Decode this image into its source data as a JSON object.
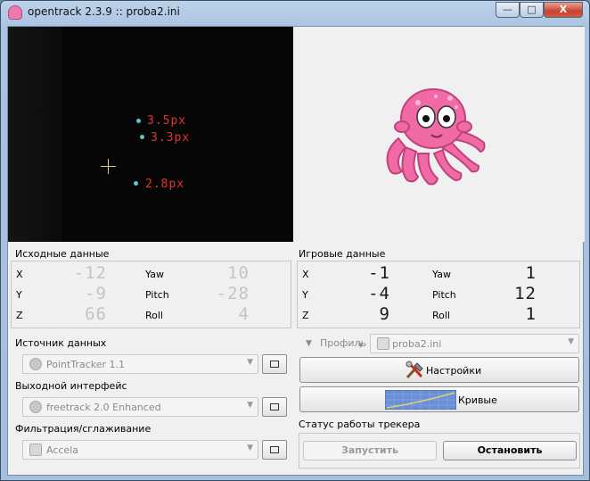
{
  "window": {
    "title": "opentrack 2.3.9 :: proba2.ini",
    "minimize": "—",
    "maximize": "□",
    "close": "X"
  },
  "video": {
    "points": [
      {
        "label": "3.5px"
      },
      {
        "label": "3.3px"
      },
      {
        "label": "2.8px"
      }
    ]
  },
  "raw": {
    "title": "Исходные данные",
    "x_label": "X",
    "x_value": "-12",
    "y_label": "Y",
    "y_value": "-9",
    "z_label": "Z",
    "z_value": "66",
    "yaw_label": "Yaw",
    "yaw_value": "10",
    "pitch_label": "Pitch",
    "pitch_value": "-28",
    "roll_label": "Roll",
    "roll_value": "4"
  },
  "game": {
    "title": "Игровые данные",
    "x_label": "X",
    "x_value": "-1",
    "y_label": "Y",
    "y_value": "-4",
    "z_label": "Z",
    "z_value": "9",
    "yaw_label": "Yaw",
    "yaw_value": "1",
    "pitch_label": "Pitch",
    "pitch_value": "12",
    "roll_label": "Roll",
    "roll_value": "1"
  },
  "tracker": {
    "label": "Источник данных",
    "value": "PointTracker 1.1"
  },
  "protocol": {
    "label": "Выходной интерфейс",
    "value": "freetrack 2.0 Enhanced"
  },
  "filter": {
    "label": "Фильтрация/сглаживание",
    "value": "Accela"
  },
  "profile": {
    "label": "Профиль",
    "value": "proba2.ini"
  },
  "buttons": {
    "settings": "Настройки",
    "curves": "Кривые",
    "start": "Запустить",
    "stop": "Остановить"
  },
  "status": {
    "title": "Статус работы трекера"
  },
  "colors": {
    "point_label": "#e43434",
    "point_dot": "#5ec8c4",
    "crosshair": "#d9d27a",
    "octopus": "#f06aa6"
  }
}
